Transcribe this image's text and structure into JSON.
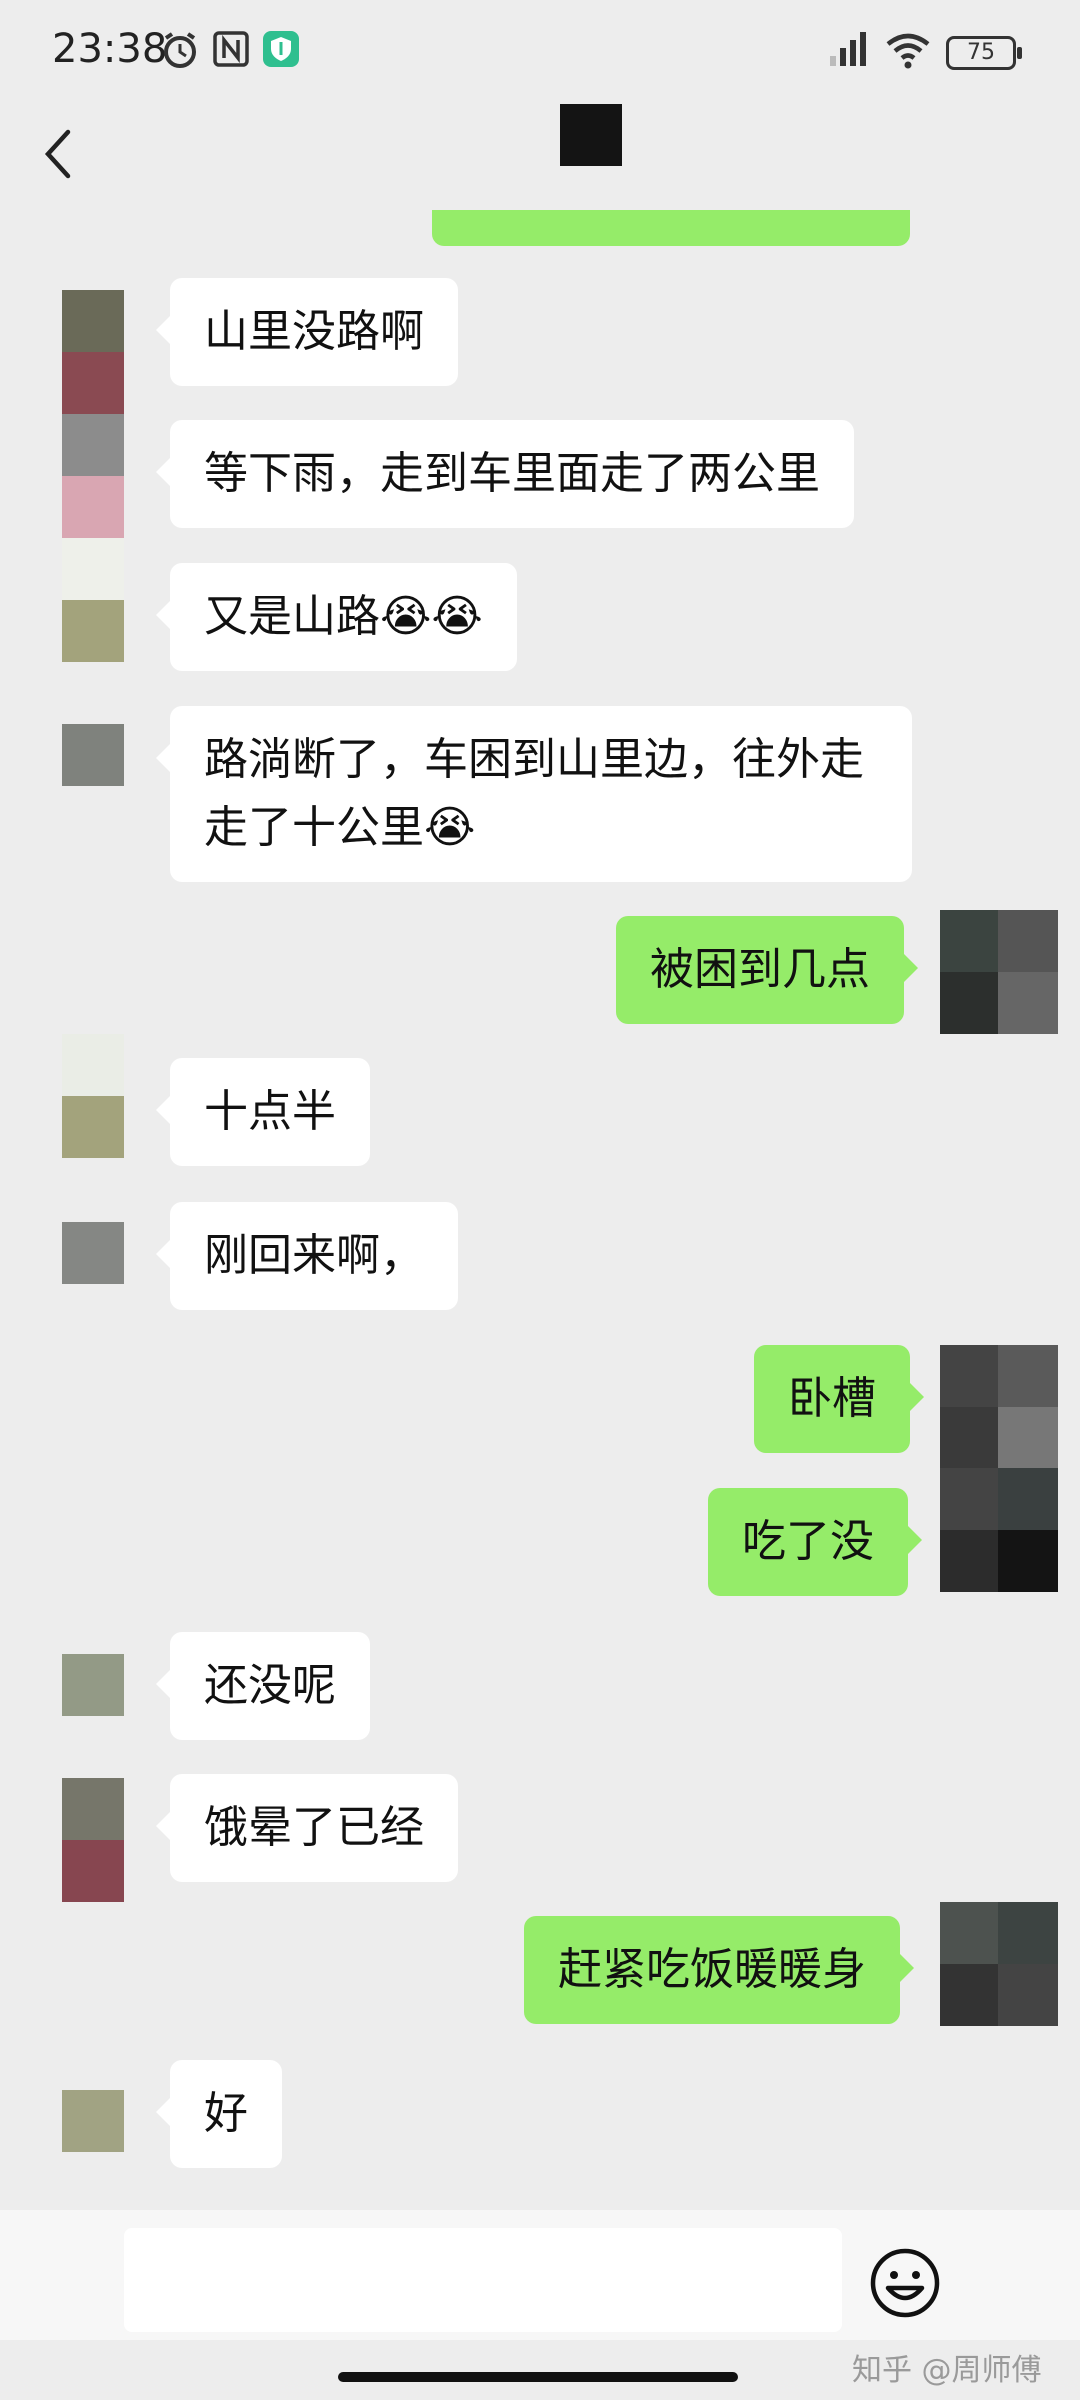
{
  "status_bar": {
    "time": "23:38",
    "battery": "75",
    "icons": [
      "alarm-icon",
      "nfc-icon",
      "vpn-shield-icon",
      "signal-icon",
      "wifi-icon",
      "battery-icon"
    ]
  },
  "header": {
    "back_icon": "chevron-left-icon"
  },
  "messages": [
    {
      "side": "in",
      "text": "山里没路啊"
    },
    {
      "side": "in",
      "text": "等下雨，走到车里面走了两公里"
    },
    {
      "side": "in",
      "text": "又是山路",
      "emoji": "😭😭"
    },
    {
      "side": "in",
      "line1": "路淌断了，车困到山里边，往外走",
      "line2": "走了十公里",
      "emoji": "😭"
    },
    {
      "side": "out",
      "text": "被困到几点"
    },
    {
      "side": "in",
      "text": "十点半"
    },
    {
      "side": "in",
      "text": "刚回来啊，"
    },
    {
      "side": "out",
      "text": "卧槽"
    },
    {
      "side": "out",
      "text": "吃了没"
    },
    {
      "side": "in",
      "text": "还没呢"
    },
    {
      "side": "in",
      "text": "饿晕了已经"
    },
    {
      "side": "out",
      "text": "赶紧吃饭暖暖身"
    },
    {
      "side": "in",
      "text": "好"
    }
  ],
  "input_bar": {
    "emoji_button_icon": "smiley-icon"
  },
  "watermark": "知乎 @周师傅",
  "colors": {
    "background": "#ededed",
    "incoming_bubble": "#ffffff",
    "outgoing_bubble": "#95ec69"
  }
}
